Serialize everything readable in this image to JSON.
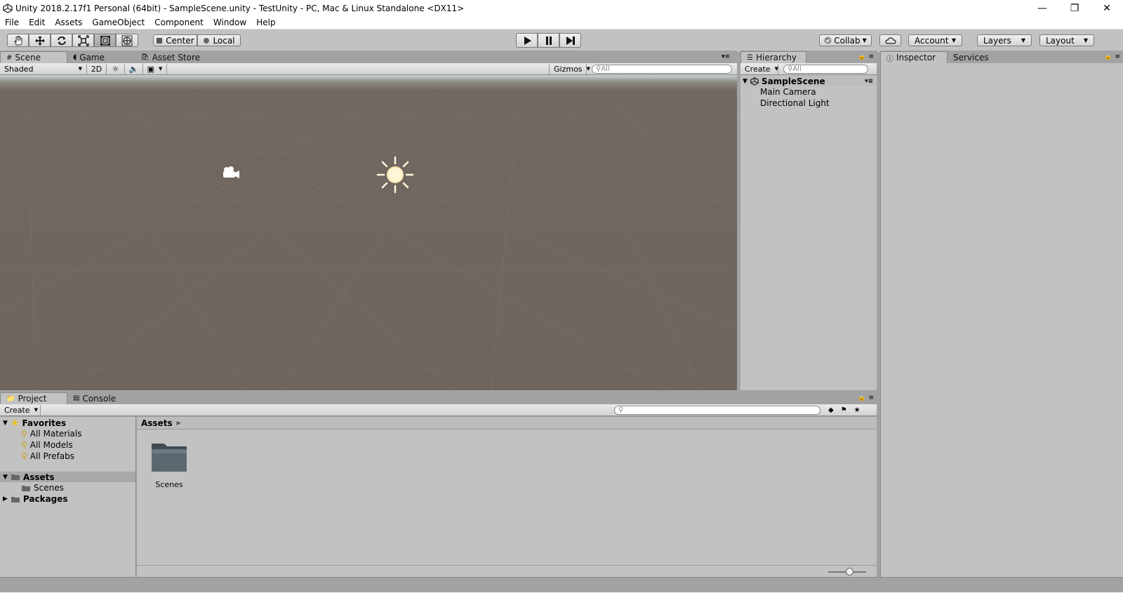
{
  "window": {
    "title": "Unity 2018.2.17f1 Personal (64bit) - SampleScene.unity - TestUnity - PC, Mac & Linux Standalone <DX11>",
    "controls": [
      "minimize-icon",
      "restore-icon",
      "close-icon"
    ]
  },
  "menu": [
    "File",
    "Edit",
    "Assets",
    "GameObject",
    "Component",
    "Window",
    "Help"
  ],
  "toolbar": {
    "tools": [
      "hand-icon",
      "move-icon",
      "rotate-icon",
      "scale-icon",
      "rect-icon",
      "transform-icon"
    ],
    "pivot": "Center",
    "space": "Local",
    "collab": "Collab",
    "account": "Account",
    "layers": "Layers",
    "layout": "Layout"
  },
  "scene_panel": {
    "tabs": [
      "Scene",
      "Game",
      "Asset Store"
    ],
    "shading": "Shaded",
    "mode_2d": "2D",
    "gizmos": "Gizmos",
    "search_placeholder": "All"
  },
  "hierarchy": {
    "tab": "Hierarchy",
    "create": "Create",
    "search_placeholder": "All",
    "scene": "SampleScene",
    "items": [
      "Main Camera",
      "Directional Light"
    ]
  },
  "inspector": {
    "tabs": [
      "Inspector",
      "Services"
    ]
  },
  "project": {
    "tabs": [
      "Project",
      "Console"
    ],
    "create": "Create",
    "favorites": {
      "label": "Favorites",
      "items": [
        "All Materials",
        "All Models",
        "All Prefabs"
      ]
    },
    "assets_root": "Assets",
    "assets_children": [
      "Scenes"
    ],
    "packages": "Packages",
    "breadcrumb": "Assets",
    "folders": [
      "Scenes"
    ]
  },
  "colors": {
    "panel": "#c2c2c2",
    "background": "#a2a2a2",
    "scene_ground": "#6e655f",
    "selection": "#a9a9a9"
  }
}
